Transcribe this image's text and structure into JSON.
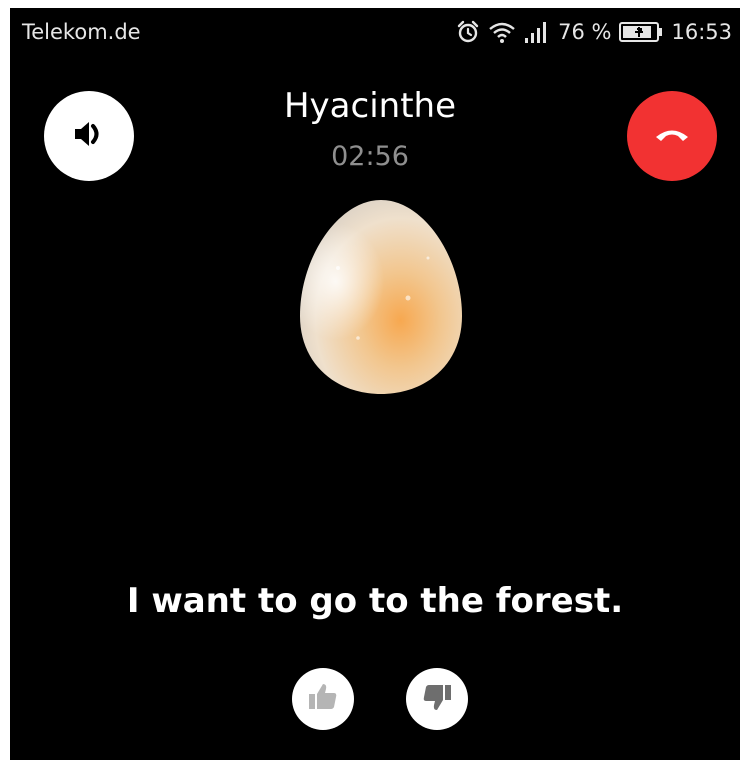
{
  "status_bar": {
    "carrier": "Telekom.de",
    "battery_percent": "76 %",
    "time": "16:53",
    "icons": [
      "alarm-icon",
      "wifi-icon",
      "signal-icon",
      "battery-charging-icon"
    ]
  },
  "call": {
    "contact_name": "Hyacinthe",
    "duration": "02:56",
    "transcript": "I want to go to the forest."
  },
  "controls": {
    "speaker": "speaker-icon",
    "hangup": "hangup-icon",
    "feedback": [
      "thumbs-up-icon",
      "thumbs-down-icon"
    ]
  },
  "colors": {
    "background": "#000000",
    "hangup": "#f23232",
    "timer": "#8f8f8f"
  }
}
